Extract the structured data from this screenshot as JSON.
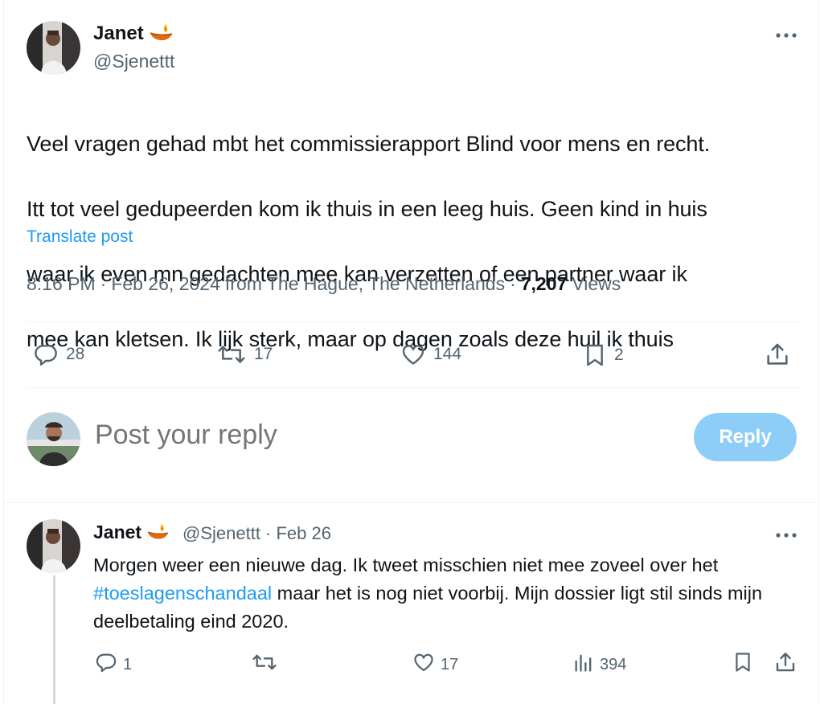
{
  "post": {
    "author_name": "Janet",
    "author_handle": "@Sjenettt",
    "text_line1": "Veel vragen gehad mbt het commissierapport Blind voor mens en recht.",
    "text_line2": "Itt tot veel gedupeerden kom ik thuis in een leeg huis. Geen kind in huis",
    "text_line3": "waar ik even mn gedachten mee kan verzetten of een partner waar ik",
    "text_line4": "mee kan kletsen. Ik lijk sterk, maar op dagen zoals deze huil ik thuis",
    "translate_label": "Translate post",
    "time": "8:16 PM",
    "date": "Feb 26, 2024",
    "location": "from The Hague, The Netherlands",
    "separator": "·",
    "views_count": "7,207",
    "views_label": "Views"
  },
  "actions": {
    "replies": "28",
    "reposts": "17",
    "likes": "144",
    "bookmarks": "2"
  },
  "composer": {
    "placeholder": "Post your reply",
    "button_label": "Reply"
  },
  "reply": {
    "author_name": "Janet",
    "author_handle_and_date": "@Sjenettt · Feb 26",
    "text_part1": "Morgen weer een nieuwe dag. Ik tweet misschien niet mee zoveel over het",
    "hashtag": "#toeslagenschandaal",
    "text_part2": " maar het is nog niet voorbij. Mijn dossier ligt stil sinds mijn deelbetaling eind 2020.",
    "replies": "1",
    "likes": "17",
    "views": "394"
  },
  "icons": {
    "name_emoji": "diya-lamp-icon",
    "more": "more-horizontal-icon",
    "reply": "reply-bubble-icon",
    "repost": "repost-arrows-icon",
    "like": "heart-icon",
    "bookmark": "bookmark-icon",
    "share": "share-upload-icon",
    "views": "bar-chart-icon"
  },
  "colors": {
    "accent": "#1d9bf0",
    "reply_button_disabled": "#8ecdf8",
    "secondary_text": "#536471",
    "divider": "#eff3f4"
  }
}
